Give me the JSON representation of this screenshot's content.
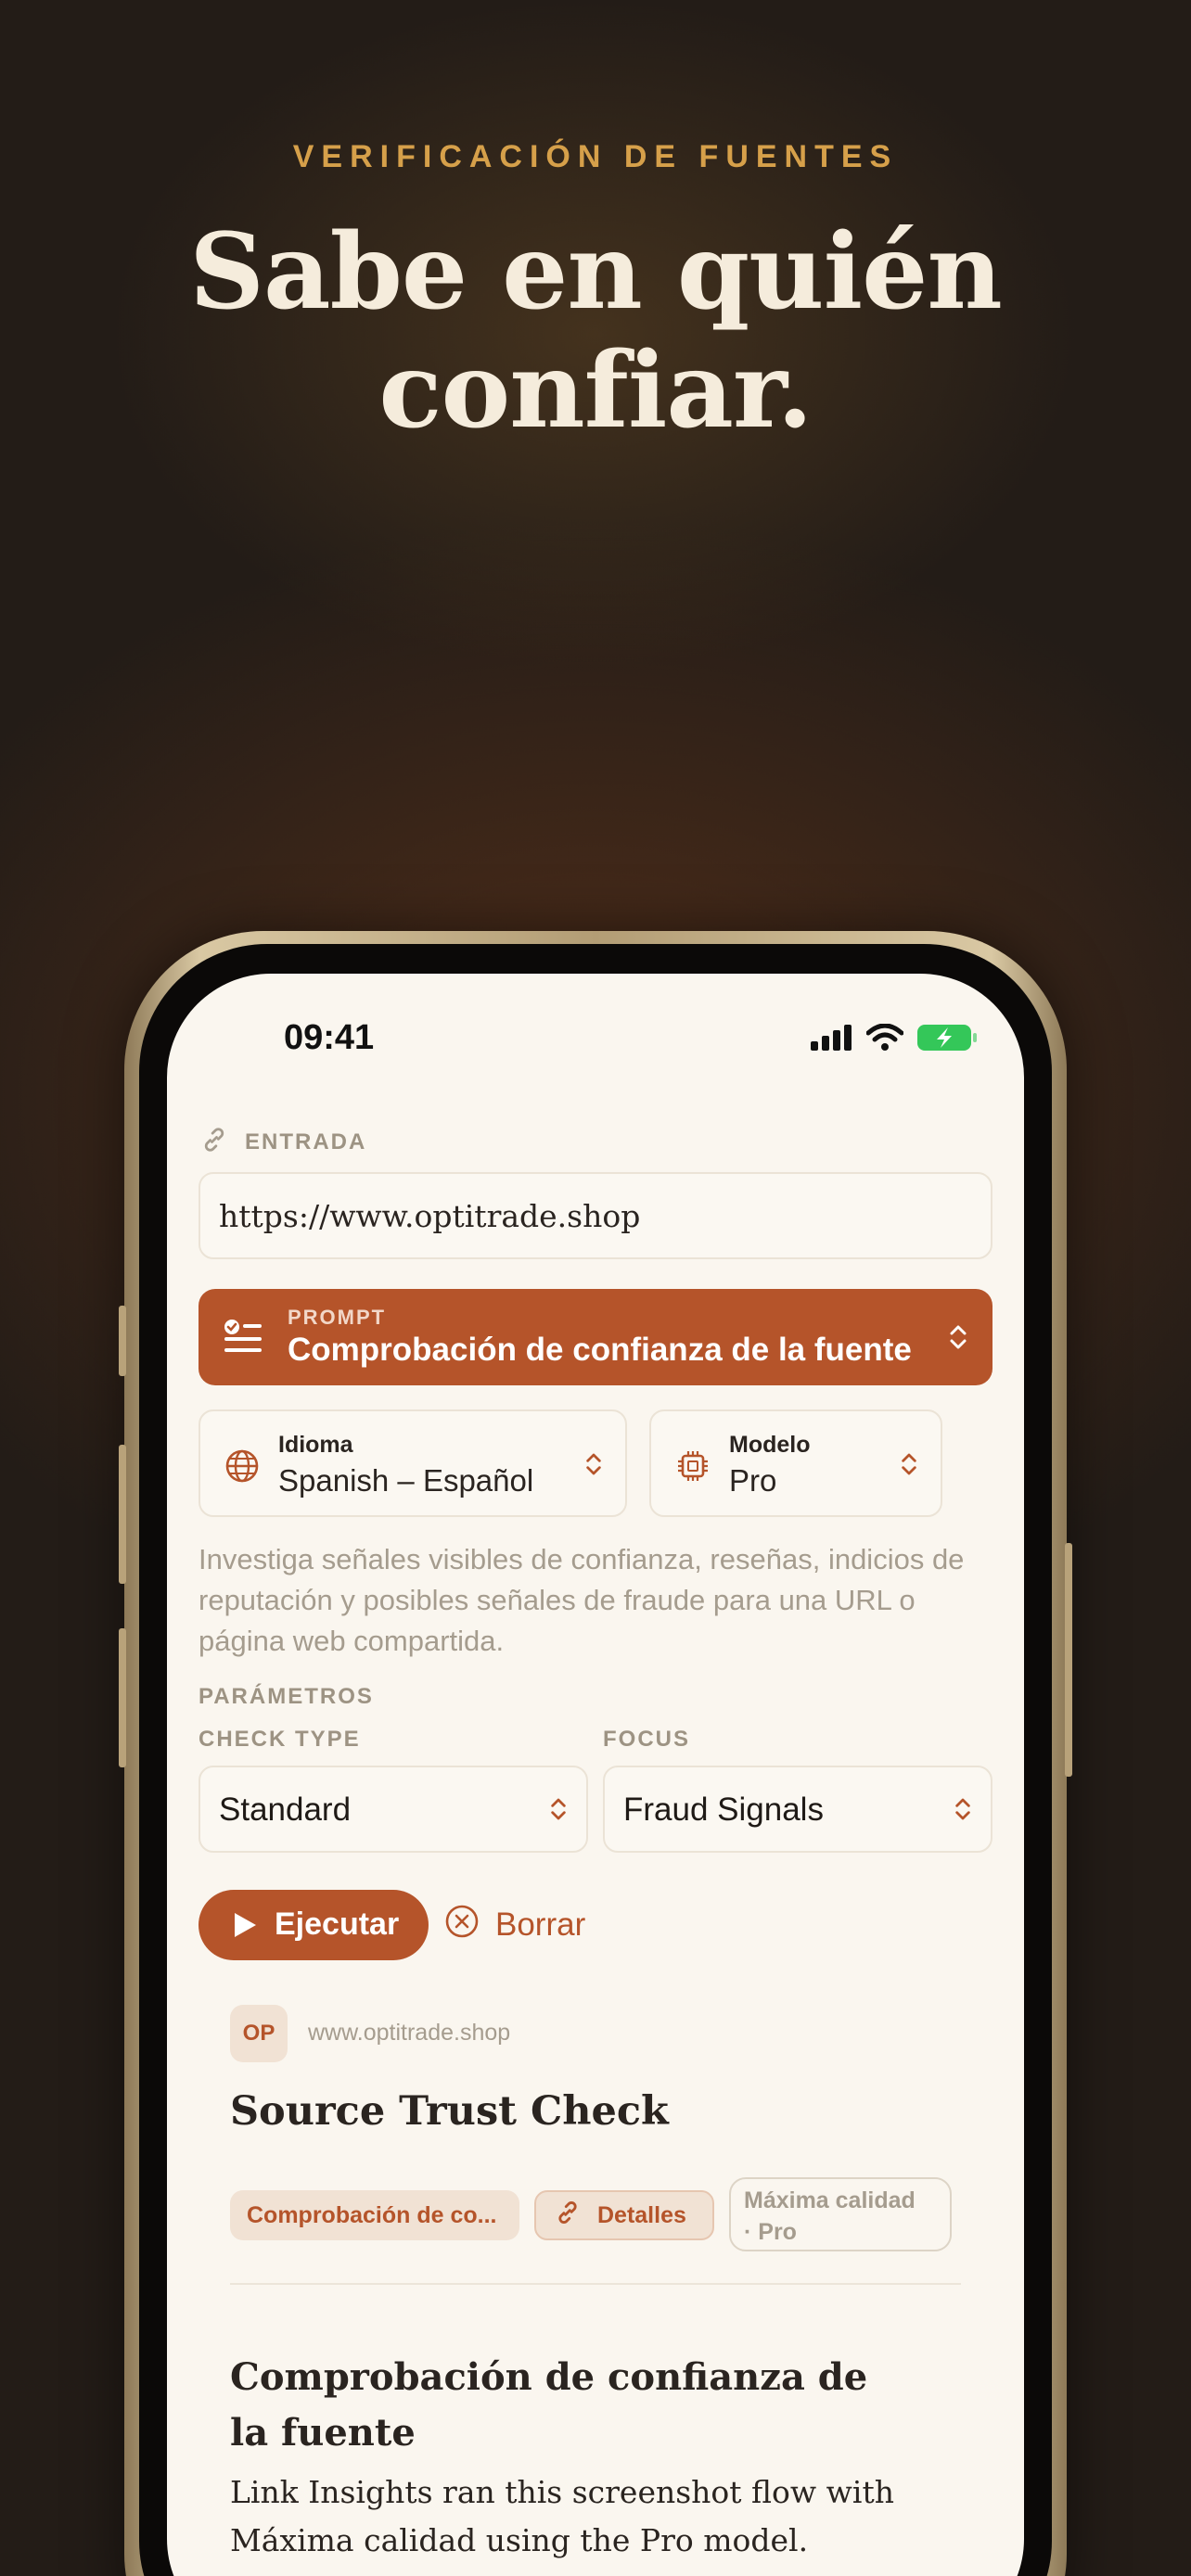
{
  "hero": {
    "eyebrow": "VERIFICACIÓN DE FUENTES",
    "headline_line1": "Sabe en quién",
    "headline_line2": "confiar."
  },
  "status_bar": {
    "time": "09:41",
    "battery_color": "#34c759"
  },
  "input_section": {
    "label": "ENTRADA",
    "url_value": "https://www.optitrade.shop"
  },
  "prompt_selector": {
    "small_label": "PROMPT",
    "value": "Comprobación de confianza de la fuente"
  },
  "language_picker": {
    "label": "Idioma",
    "value": "Spanish – Español"
  },
  "model_picker": {
    "label": "Modelo",
    "value": "Pro"
  },
  "description": "Investiga señales visibles de confianza, reseñas, indicios de reputación y posibles señales de fraude para una URL o página web compartida.",
  "parameters": {
    "label": "PARÁMETROS",
    "check_type_label": "CHECK TYPE",
    "check_type_value": "Standard",
    "focus_label": "FOCUS",
    "focus_value": "Fraud Signals"
  },
  "actions": {
    "run_label": "Ejecutar",
    "clear_label": "Borrar"
  },
  "result_card": {
    "avatar_initials": "OP",
    "domain": "www.optitrade.shop",
    "title": "Source Trust Check",
    "chip_prompt": "Comprobación de co...",
    "chip_details": "Detalles",
    "chip_quality_line1": "Máxima calidad",
    "chip_quality_line2": "· Pro",
    "section_title": "Comprobación de confianza de la fuente",
    "body": "Link Insights ran this screenshot flow with Máxima calidad using the Pro model."
  },
  "colors": {
    "accent": "#b5542a",
    "background": "#231c17",
    "screen": "#faf6ef",
    "eyebrow": "#d6a04a"
  }
}
